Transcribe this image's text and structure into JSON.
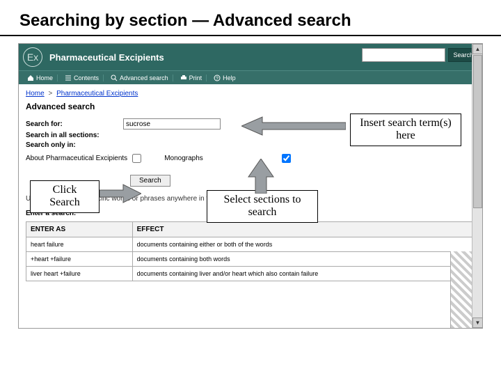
{
  "slide_title": "Searching by section — Advanced search",
  "header": {
    "product_name": "Pharmaceutical Excipients",
    "logo_text": "Ex",
    "top_search_button": "Search",
    "top_search_placeholder": ""
  },
  "nav": {
    "home": "Home",
    "contents": "Contents",
    "advanced": "Advanced search",
    "print": "Print",
    "help": "Help"
  },
  "breadcrumb": {
    "home": "Home",
    "sep": ">",
    "current": "Pharmaceutical Excipients"
  },
  "page_heading": "Advanced search",
  "form": {
    "search_for_label": "Search for:",
    "search_for_value": "sucrose",
    "search_in_label": "Search in all sections:",
    "search_only_label": "Search only in:",
    "option_about": "About Pharmaceutical Excipients",
    "option_monographs": "Monographs",
    "checkbox_about_checked": false,
    "checkbox_monographs_checked": true,
    "search_button": "Search"
  },
  "hint_text": "Use 'search' to find specific words or phrases anywhere in the text.",
  "enter_search_label": "Enter a search:",
  "table": {
    "col1": "ENTER AS",
    "col2": "EFFECT",
    "rows": [
      {
        "q": "heart failure",
        "e": "documents containing either or both of the words"
      },
      {
        "q": "+heart +failure",
        "e": "documents containing both words"
      },
      {
        "q": "liver heart +failure",
        "e": "documents containing liver and/or heart which also contain failure"
      }
    ]
  },
  "callouts": {
    "insert": "Insert search term(s) here",
    "select": "Select sections to search",
    "click": "Click Search"
  }
}
